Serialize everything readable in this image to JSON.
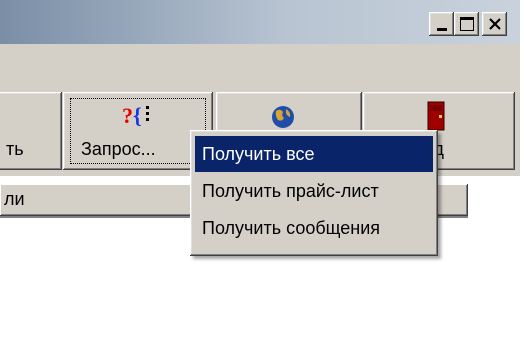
{
  "window": {
    "controls": [
      {
        "name": "minimize",
        "icon": "minimize-icon"
      },
      {
        "name": "maximize",
        "icon": "maximize-icon"
      },
      {
        "name": "close",
        "icon": "close-icon"
      }
    ]
  },
  "toolbar": {
    "buttons": [
      {
        "label": "ть",
        "icon": ""
      },
      {
        "label": "Запрос...",
        "icon": "query-icon"
      },
      {
        "label": "",
        "icon": "globe-icon"
      },
      {
        "label": "ход",
        "icon": "exit-door-icon"
      }
    ]
  },
  "list": {
    "header": "ли"
  },
  "context_menu": {
    "items": [
      {
        "label": "Получить все",
        "selected": true
      },
      {
        "label": "Получить прайс-лист",
        "selected": false
      },
      {
        "label": "Получить сообщения",
        "selected": false
      }
    ]
  },
  "colors": {
    "face": "#d4d0c8",
    "selection": "#0a246a",
    "door": "#a00000",
    "question": "#e00000",
    "brace": "#1a36e8"
  }
}
